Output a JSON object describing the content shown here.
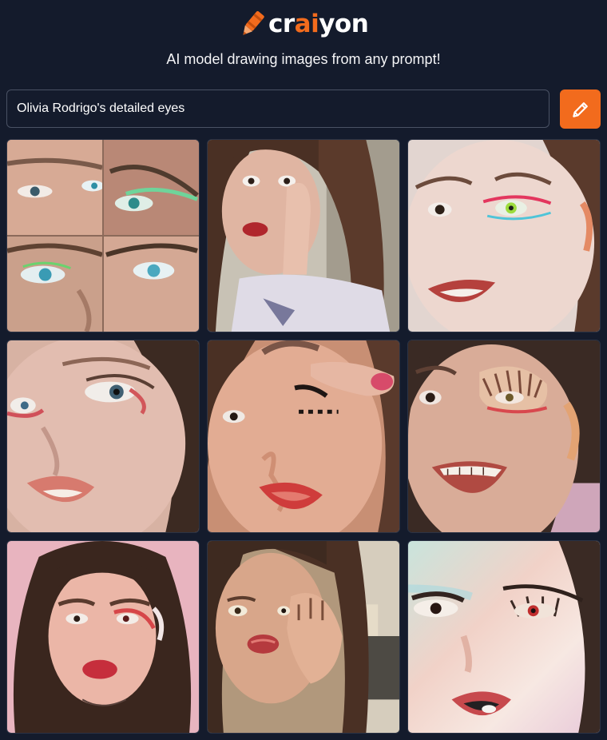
{
  "header": {
    "logo_text_pre": "cr",
    "logo_text_accent": "ai",
    "logo_text_post": "yon",
    "tagline": "AI model drawing images from any prompt!"
  },
  "prompt": {
    "value": "Olivia Rodrigo's detailed eyes",
    "button_icon": "pencil-icon"
  },
  "colors": {
    "background": "#141b2c",
    "accent": "#f26b1d",
    "text": "#ffffff"
  },
  "results": [
    {
      "label": "generated-image-1"
    },
    {
      "label": "generated-image-2"
    },
    {
      "label": "generated-image-3"
    },
    {
      "label": "generated-image-4"
    },
    {
      "label": "generated-image-5"
    },
    {
      "label": "generated-image-6"
    },
    {
      "label": "generated-image-7"
    },
    {
      "label": "generated-image-8"
    },
    {
      "label": "generated-image-9"
    }
  ]
}
